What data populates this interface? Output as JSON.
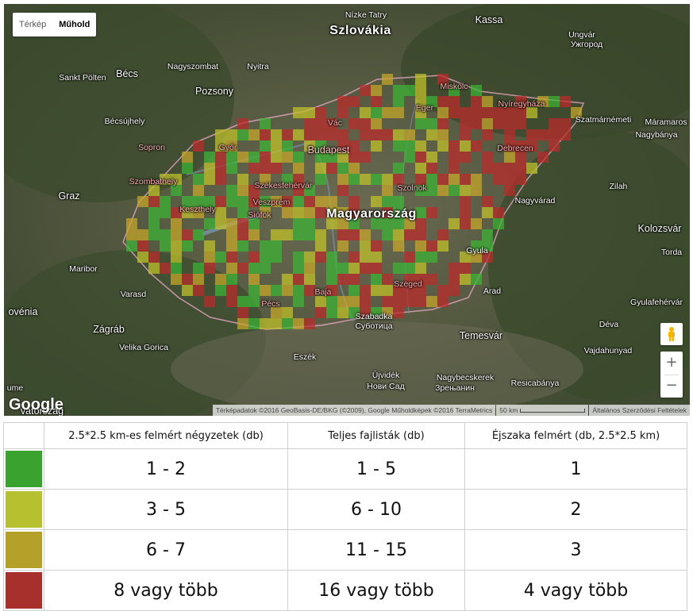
{
  "map": {
    "type_buttons": {
      "map": "Térkép",
      "satellite": "Műhold"
    },
    "places": {
      "szlovakia": "Szlovákia",
      "magyarorszag": "Magyarország",
      "kassa": "Kassa",
      "ungvar": "Ungvár",
      "ungvar2": "Ужгород",
      "becs": "Bécs",
      "pozsony": "Pozsony",
      "nagyszombat": "Nagyszombat",
      "nyitra": "Nyitra",
      "sanktpolten": "Sankt Pölten",
      "becsujhely": "Bécsújhely",
      "sopron": "Sopron",
      "gyor": "Győr",
      "budapest": "Budapest",
      "vac": "Vác",
      "eger": "Eger",
      "miskolc": "Miskolc",
      "nyiregyhaza": "Nyíregyháza",
      "szatmarnemeti": "Szatmárnémeti",
      "maramaros": "Máramaros",
      "nagybanya": "Nagybánya",
      "debrecen": "Debrecen",
      "szombathely": "Szombathely",
      "szekesfehervar": "Székesfehérvár",
      "veszprem": "Veszprém",
      "siofok": "Siófok",
      "szolnok": "Szolnok",
      "nagyvarad": "Nagyvárad",
      "zilah": "Zilah",
      "kolozsvar": "Kolozsvár",
      "torda": "Torda",
      "graz": "Graz",
      "keszthely": "Keszthely",
      "gyula": "Gyula",
      "maribor": "Maribor",
      "varasd": "Varasd",
      "pecs": "Pécs",
      "baja": "Baja",
      "szeged": "Szeged",
      "arad": "Arad",
      "gyulafehervar": "Gyulafehérvár",
      "szabadka": "Szabadka",
      "szabadka2": "Суботица",
      "temesvar": "Temesvár",
      "deva": "Déva",
      "vajdahunyad": "Vajdahunyad",
      "zagrab": "Zágráb",
      "velikagorica": "Velika Gorica",
      "eszek": "Eszék",
      "ujvidek": "Újvidék",
      "ujvidek2": "Нови Сад",
      "nagybecskerek": "Nagybecskerek",
      "nagybecskerek2": "Зрењанин",
      "resicabanya": "Resicabánya",
      "nizketatry": "Nízke Tatry",
      "slovenia_edge": "ovénia",
      "croatia_edge": "vatország",
      "bosnia_edge": "ume"
    },
    "attribution": "Térképadatok ©2016 GeoBasis-DE/BKG (©2009), Google Műholdképek ©2016 TerraMetrics",
    "scale": "50 km",
    "terms": "Általános Szerződési Feltételek",
    "logo": "Google",
    "zoom_in": "+",
    "zoom_out": "−",
    "grid_colors": {
      "green": "#3cb534",
      "yellow": "#c2c42a",
      "olive": "#c9a82a",
      "red": "#bd2a2a"
    }
  },
  "legend": {
    "headers": [
      "",
      "2.5*2.5 km-es felmért négyzetek (db)",
      "Teljes fajlisták (db)",
      "Éjszaka felmért (db, 2.5*2.5 km)"
    ],
    "rows": [
      {
        "color": "#3aa22f",
        "squares": "1 - 2",
        "lists": "1 - 5",
        "night": "1"
      },
      {
        "color": "#b7c02f",
        "squares": "3 - 5",
        "lists": "6 - 10",
        "night": "2"
      },
      {
        "color": "#b5a02a",
        "squares": "6 - 7",
        "lists": "11 - 15",
        "night": "3"
      },
      {
        "color": "#a8302c",
        "squares": "8 vagy több",
        "lists": "16 vagy több",
        "night": "4 vagy több"
      }
    ]
  }
}
